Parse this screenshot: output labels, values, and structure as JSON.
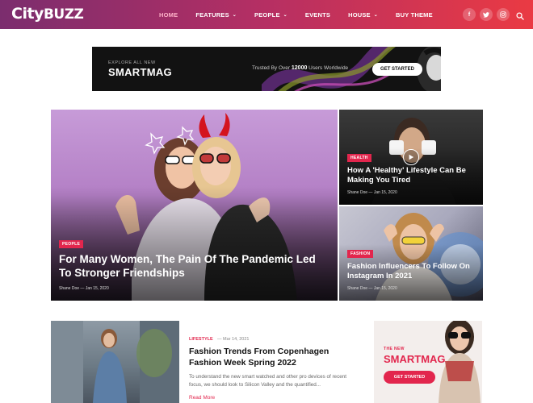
{
  "header": {
    "logo_prefix": "City",
    "logo_suffix": "BUZZ",
    "nav": [
      {
        "label": "HOME",
        "active": true,
        "dropdown": false
      },
      {
        "label": "FEATURES",
        "active": false,
        "dropdown": true
      },
      {
        "label": "PEOPLE",
        "active": false,
        "dropdown": true
      },
      {
        "label": "EVENTS",
        "active": false,
        "dropdown": false
      },
      {
        "label": "HOUSE",
        "active": false,
        "dropdown": true
      },
      {
        "label": "BUY THEME",
        "active": false,
        "dropdown": false
      }
    ],
    "social": [
      "facebook-icon",
      "twitter-icon",
      "instagram-icon"
    ],
    "search_icon": "search-icon"
  },
  "banner": {
    "eyebrow": "EXPLORE ALL NEW",
    "title": "SMARTMAG",
    "trust_prefix": "Trusted By Over",
    "trust_count": "12000",
    "trust_suffix": "Users Worldwide",
    "cta": "GET STARTED"
  },
  "featured": {
    "main": {
      "category": "PEOPLE",
      "title": "For Many Women, The Pain Of The Pandemic Led To Stronger Friendships",
      "author": "Shane Doe",
      "date": "Jan 15, 2020"
    },
    "side": [
      {
        "category": "HEALTH",
        "title": "How A 'Healthy' Lifestyle Can Be Making You Tired",
        "author": "Shane Doe",
        "date": "Jan 15, 2020",
        "video": true
      },
      {
        "category": "FASHION",
        "title": "Fashion Influencers To Follow On Instagram In 2021",
        "author": "Shane Doe",
        "date": "Jan 15, 2020",
        "video": false
      }
    ]
  },
  "post": {
    "category": "LIFESTYLE",
    "date": "Mar 14, 2021",
    "title": "Fashion Trends From Copenhagen Fashion Week Spring 2022",
    "excerpt": "To understand the new smart watched and other pro devices of recent focus, we should look to Silicon Valley and the quantified...",
    "read_more": "Read More"
  },
  "ad": {
    "eyebrow": "THE NEW",
    "title": "SMARTMAG",
    "cta": "GET STARTED"
  },
  "colors": {
    "accent": "#e2264d",
    "header_start": "#7b2d6e",
    "header_end": "#ea3a43"
  }
}
